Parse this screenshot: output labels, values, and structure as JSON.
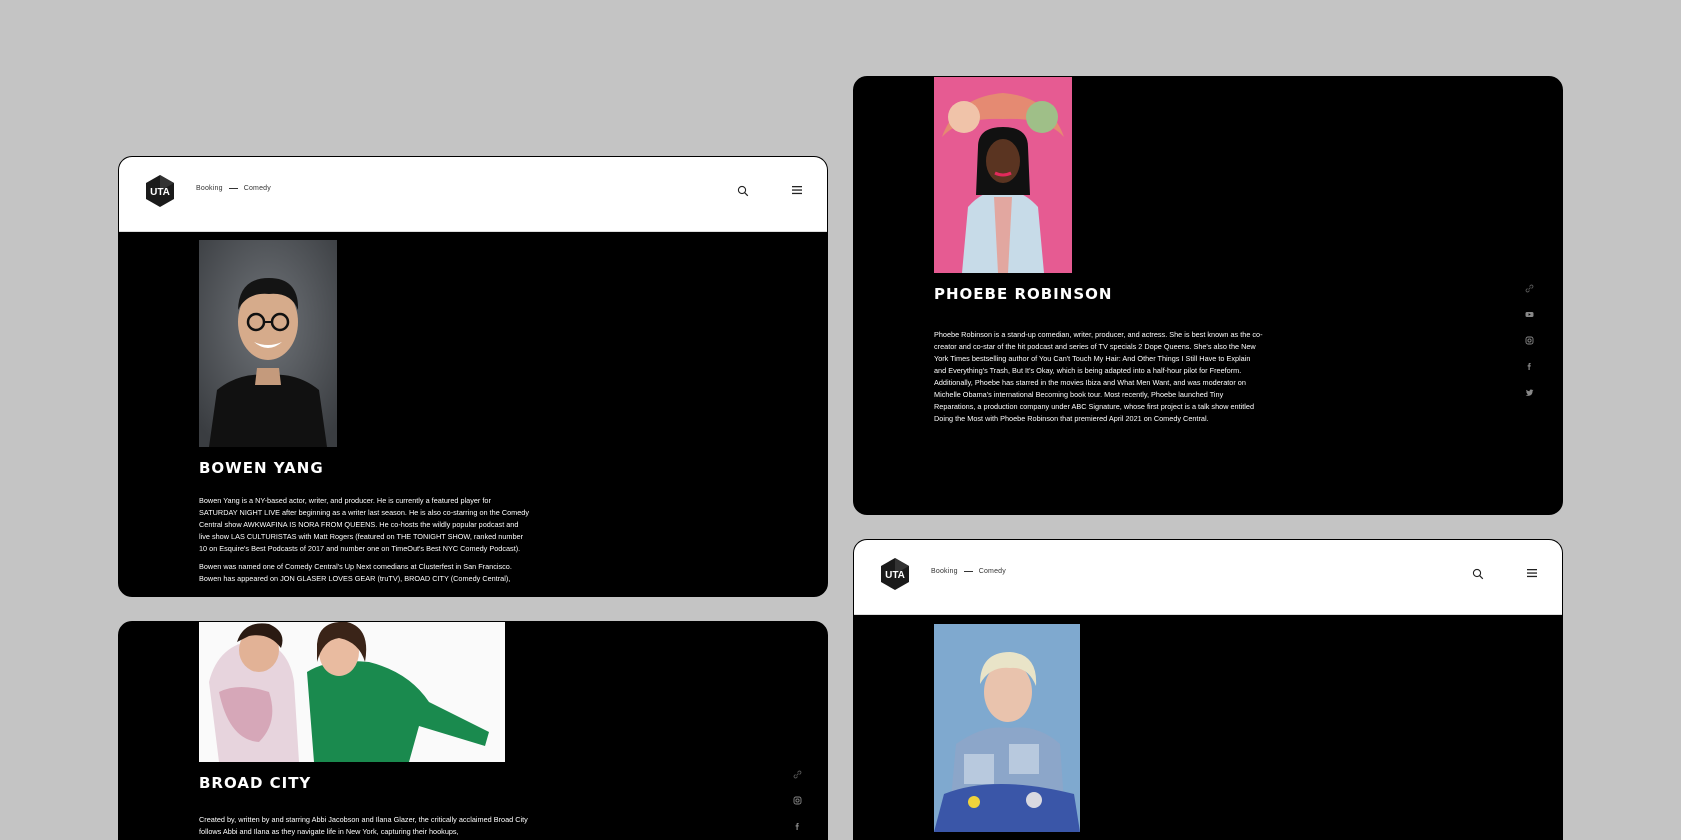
{
  "bowen": {
    "breadcrumb": {
      "first": "Booking",
      "second": "Comedy"
    },
    "logo_text": "UTA",
    "name": "BOWEN YANG",
    "bio_p1": "Bowen Yang is a NY-based actor, writer, and producer. He is currently a featured player for SATURDAY NIGHT LIVE after beginning as a writer last season. He is also co-starring on the Comedy Central show AWKWAFINA IS NORA FROM QUEENS. He co-hosts the wildly popular podcast and live show LAS CULTURISTAS with Matt Rogers (featured on THE TONIGHT SHOW, ranked number 10 on Esquire's Best Podcasts of 2017 and number one on TimeOut's Best NYC Comedy Podcast).",
    "bio_p2": "Bowen was named one of Comedy Central's Up Next comedians at Clusterfest in San Francisco. Bowen has appeared on JON GLASER LOVES GEAR (truTV), BROAD CITY (Comedy Central),"
  },
  "phoebe": {
    "name": "PHOEBE ROBINSON",
    "bio": "Phoebe Robinson is a stand-up comedian, writer, producer, and actress. She is best known as the co-creator and co-star of the hit podcast and series of TV specials 2 Dope Queens. She's also the New York Times bestselling author of You Can't Touch My Hair: And Other Things I Still Have to Explain and Everything's Trash, But It's Okay, which is being adapted into a half-hour pilot for Freeform. Additionally, Phoebe has starred in the movies Ibiza and What Men Want, and was moderator on Michelle Obama's international Becoming book tour. Most recently, Phoebe launched Tiny Reparations, a production company under ABC Signature, whose first project is a talk show entitled Doing the Most with Phoebe Robinson that premiered April 2021 on Comedy Central."
  },
  "broad": {
    "name": "BROAD CITY",
    "bio": "Created by, written by and starring Abbi Jacobson and Ilana Glazer, the critically acclaimed Broad City follows Abbi and Ilana as they navigate life in New York, capturing their hookups,"
  },
  "fourth": {
    "breadcrumb": {
      "first": "Booking",
      "second": "Comedy"
    },
    "logo_text": "UTA"
  },
  "colors": {
    "background": "#c4c4c4",
    "card": "#000000",
    "header": "#ffffff",
    "text": "#ffffff"
  }
}
